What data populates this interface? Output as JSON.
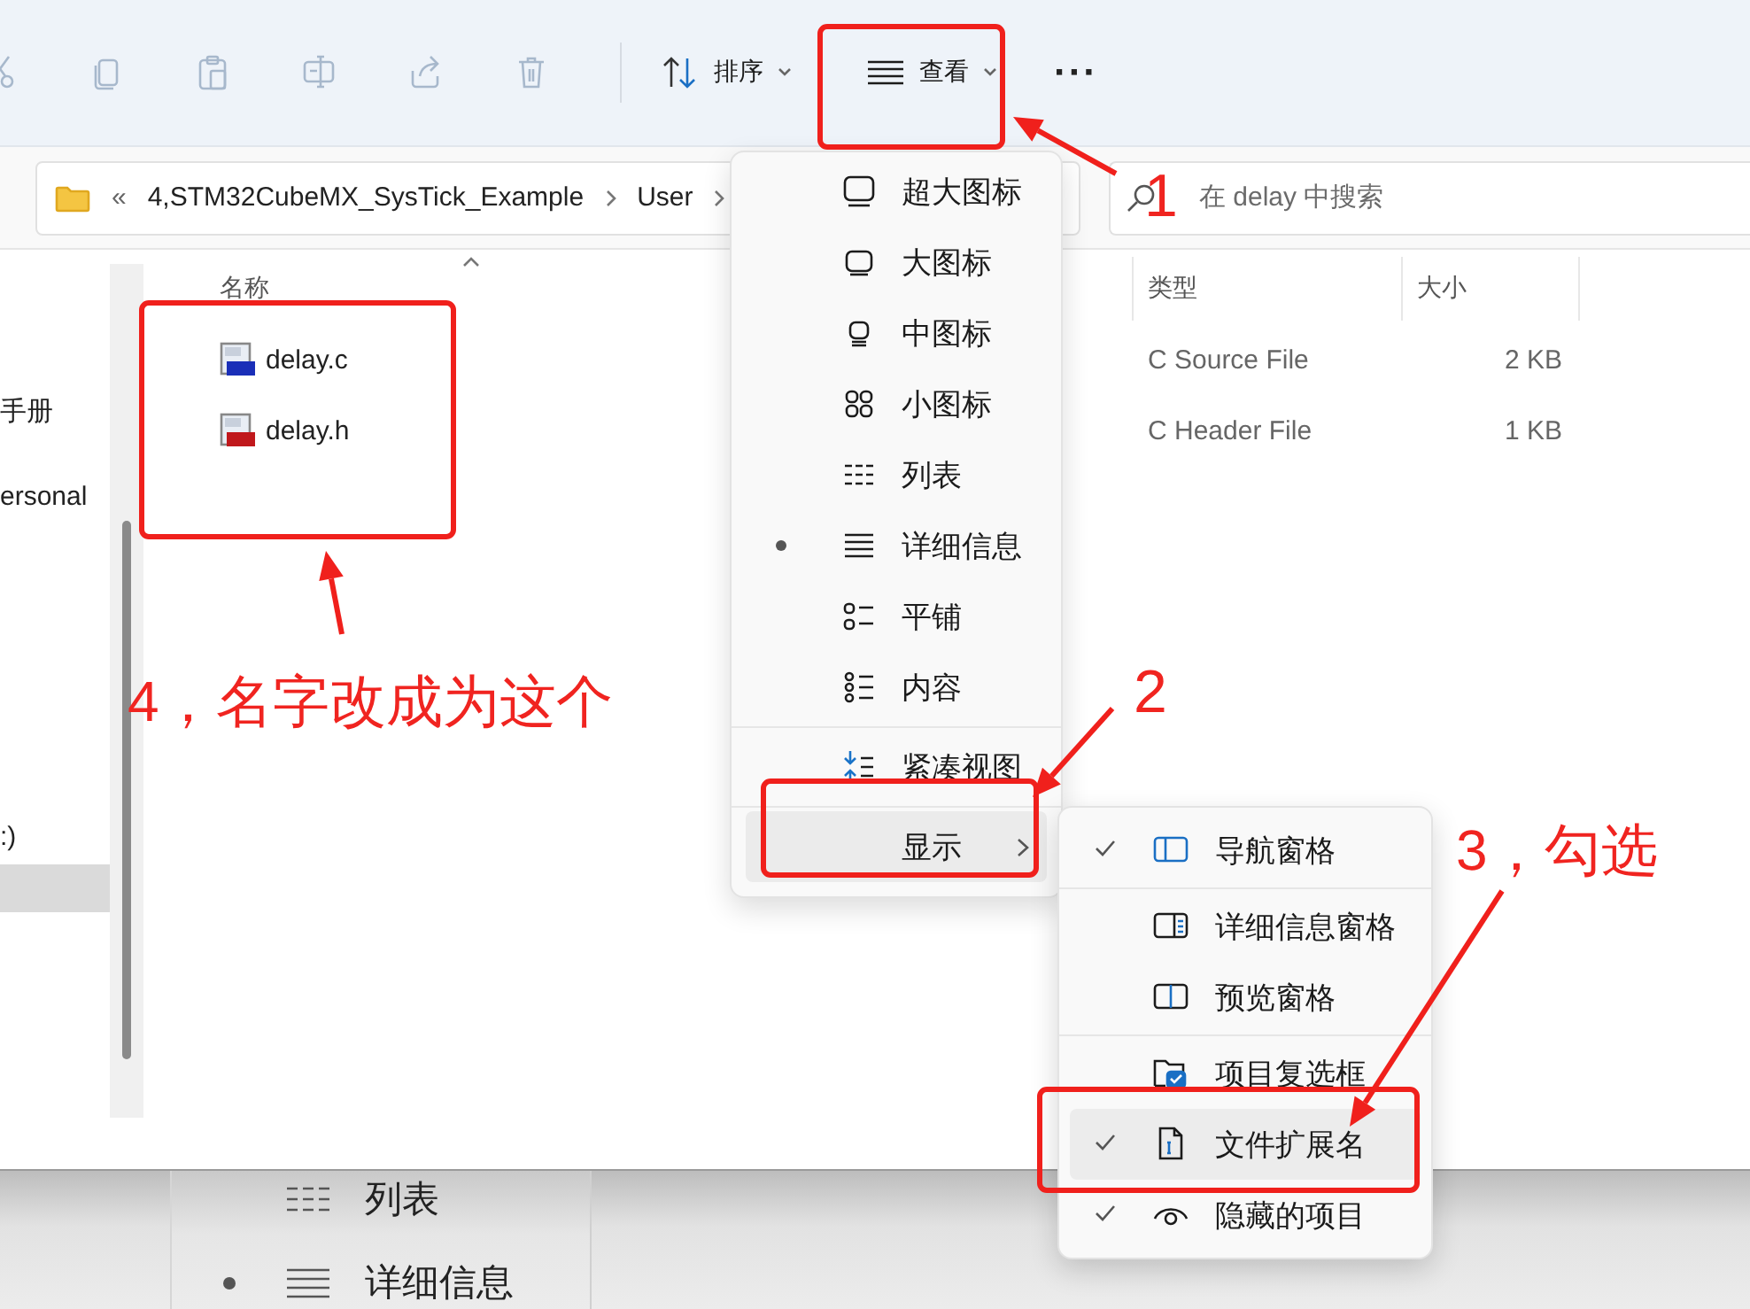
{
  "toolbar": {
    "icon_buttons": [
      {
        "kind": "cut",
        "disabled": true
      },
      {
        "kind": "copy",
        "disabled": true
      },
      {
        "kind": "paste",
        "disabled": true
      },
      {
        "kind": "rename",
        "disabled": true
      },
      {
        "kind": "share",
        "disabled": true
      },
      {
        "kind": "delete",
        "disabled": true
      }
    ],
    "sort": {
      "label": "排序"
    },
    "view": {
      "label": "查看"
    },
    "more": "···"
  },
  "address": {
    "overflow": "«",
    "crumbs": [
      "4,STM32CubeMX_SysTick_Example",
      "User"
    ]
  },
  "search": {
    "placeholder": "在 delay 中搜索"
  },
  "sidebar": {
    "items": [
      {
        "label": "手册"
      },
      {
        "label": "ersonal"
      },
      {
        "label": ":)"
      }
    ]
  },
  "table": {
    "columns": [
      "名称",
      "类型",
      "大小"
    ],
    "rows": [
      {
        "name": "delay.c",
        "kind": "c",
        "type": "C Source File",
        "size": "2 KB"
      },
      {
        "name": "delay.h",
        "kind": "h",
        "type": "C Header File",
        "size": "1 KB"
      }
    ]
  },
  "view_menu": {
    "groups": [
      [
        {
          "label": "超大图标",
          "kind": "xl",
          "selected": false
        },
        {
          "label": "大图标",
          "kind": "large",
          "selected": false
        },
        {
          "label": "中图标",
          "kind": "medium",
          "selected": false
        },
        {
          "label": "小图标",
          "kind": "small",
          "selected": false
        },
        {
          "label": "列表",
          "kind": "list",
          "selected": false
        },
        {
          "label": "详细信息",
          "kind": "details",
          "selected": true
        },
        {
          "label": "平铺",
          "kind": "tiles",
          "selected": false
        },
        {
          "label": "内容",
          "kind": "content",
          "selected": false
        }
      ],
      [
        {
          "label": "紧凑视图",
          "kind": "compact",
          "selected": false
        }
      ]
    ],
    "show": {
      "label": "显示",
      "highlighted": true
    }
  },
  "show_menu": {
    "groups": [
      [
        {
          "label": "导航窗格",
          "kind": "nav",
          "checked": true,
          "highlighted": false
        }
      ],
      [
        {
          "label": "详细信息窗格",
          "kind": "detailspane",
          "checked": false,
          "highlighted": false
        },
        {
          "label": "预览窗格",
          "kind": "preview",
          "checked": false,
          "highlighted": false
        }
      ],
      [
        {
          "label": "项目复选框",
          "kind": "checkbox",
          "checked": false,
          "highlighted": false
        },
        {
          "label": "文件扩展名",
          "kind": "file",
          "checked": true,
          "highlighted": true
        },
        {
          "label": "隐藏的项目",
          "kind": "eye",
          "checked": true,
          "highlighted": false
        }
      ]
    ]
  },
  "background_menu": {
    "items": [
      {
        "label": "列表",
        "selected": false
      },
      {
        "label": "详细信息",
        "selected": true
      }
    ]
  },
  "annotations": [
    {
      "text": "1"
    },
    {
      "text": "2"
    },
    {
      "text": "3，勾选"
    },
    {
      "text": "4，名字改成为这个"
    }
  ]
}
